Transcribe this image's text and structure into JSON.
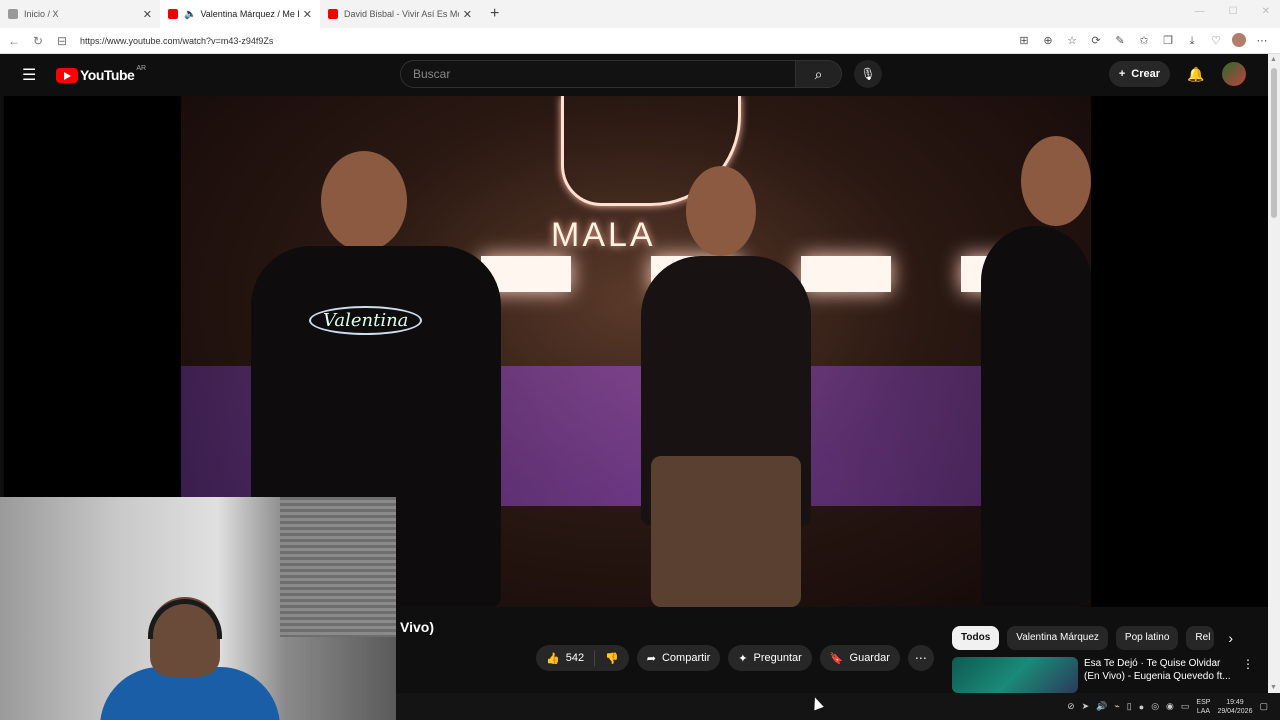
{
  "browser": {
    "tabs": [
      {
        "label": "Inicio / X",
        "favicon": "x-icon",
        "active": false
      },
      {
        "label": "Valentina Márquez / Me Ded...",
        "favicon": "youtube-icon",
        "active": true
      },
      {
        "label": "David Bisbal - Vivir Así Es Morir De...",
        "favicon": "youtube-icon",
        "active": false
      }
    ],
    "new_tab": "+",
    "url": "https://www.youtube.com/watch?v=m43-z94f9Zs"
  },
  "youtube": {
    "logo_text": "YouTube",
    "country": "AR",
    "search_placeholder": "Buscar",
    "create_label": "Crear",
    "video_title_fragment": "Vivo)",
    "neon_sign": "MALA",
    "shirt_text": "Valentina",
    "likes": "542",
    "share_label": "Compartir",
    "ask_label": "Preguntar",
    "save_label": "Guardar",
    "chips": [
      "Todos",
      "Valentina Márquez",
      "Pop latino",
      "Rel"
    ],
    "recommendation_title": "Esa Te Dejó · Te Quise Olvidar (En Vivo) - Eugenia Quevedo ft..."
  },
  "taskbar": {
    "lang": "ESP",
    "lang_sub": "LAA",
    "time": "19:49",
    "date": "29/04/2026"
  },
  "colors": {
    "yt_red": "#ff0000",
    "bg": "#0f0f0f"
  }
}
